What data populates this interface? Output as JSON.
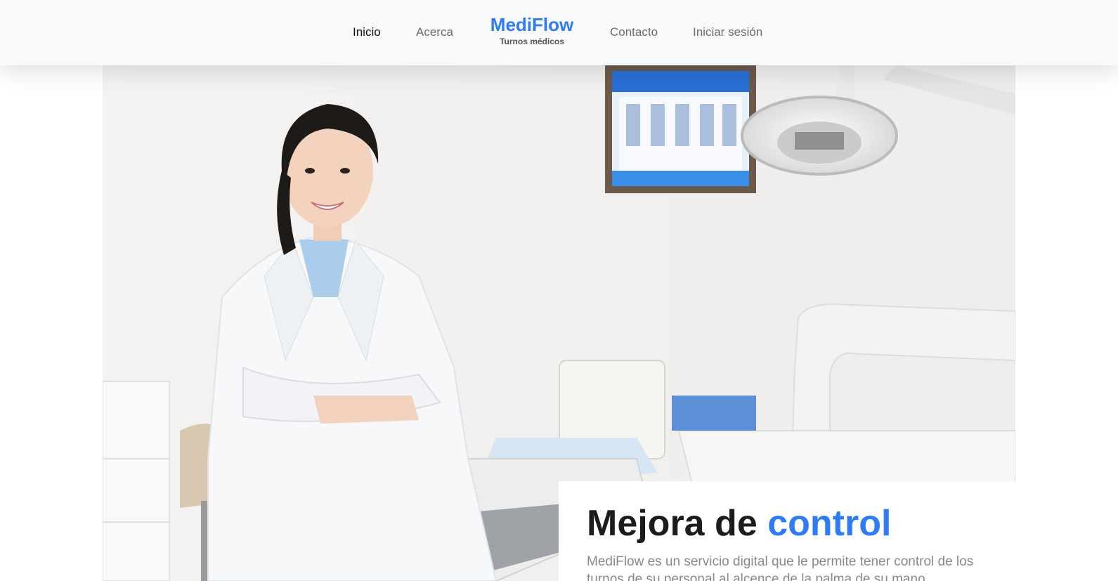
{
  "nav": {
    "links_left": [
      {
        "label": "Inicio",
        "active": true
      },
      {
        "label": "Acerca",
        "active": false
      }
    ],
    "brand": {
      "title": "MediFlow",
      "subtitle": "Turnos médicos"
    },
    "links_right": [
      {
        "label": "Contacto",
        "active": false
      },
      {
        "label": "Iniciar sesión",
        "active": false
      }
    ]
  },
  "hero": {
    "image": "smiling-doctor-in-dental-clinic-photo",
    "headline_main": "Mejora de",
    "headline_accent": "control",
    "description": "MediFlow es un servicio digital que le permite tener control de los turnos de su personal al alcence de la palma de su mano"
  },
  "colors": {
    "accent": "#2f7af5",
    "nav_bg": "#f8f9fa",
    "text_dark": "#1c1c1c",
    "text_muted": "#8a8a8a"
  }
}
